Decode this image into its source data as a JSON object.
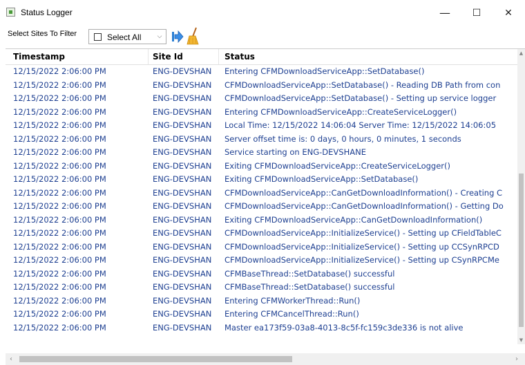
{
  "window": {
    "title": "Status Logger",
    "minimize": "—",
    "maximize": "☐",
    "close": "✕"
  },
  "toolbar": {
    "filter_label": "Select Sites To Filter",
    "select_all_label": "Select All"
  },
  "table": {
    "columns": [
      "Timestamp",
      "Site Id",
      "Status"
    ],
    "rows": [
      [
        "12/15/2022 2:06:00 PM",
        "ENG-DEVSHAN",
        "Entering CFMDownloadServiceApp::SetDatabase()"
      ],
      [
        "12/15/2022 2:06:00 PM",
        "ENG-DEVSHAN",
        "CFMDownloadServiceApp::SetDatabase() - Reading DB Path from con"
      ],
      [
        "12/15/2022 2:06:00 PM",
        "ENG-DEVSHAN",
        "CFMDownloadServiceApp::SetDatabase() - Setting up service logger"
      ],
      [
        "12/15/2022 2:06:00 PM",
        "ENG-DEVSHAN",
        "Entering CFMDownloadServiceApp::CreateServiceLogger()"
      ],
      [
        "12/15/2022 2:06:00 PM",
        "ENG-DEVSHAN",
        "Local Time: 12/15/2022 14:06:04 Server Time: 12/15/2022 14:06:05"
      ],
      [
        "12/15/2022 2:06:00 PM",
        "ENG-DEVSHAN",
        "Server offset time is: 0 days, 0 hours, 0 minutes, 1 seconds"
      ],
      [
        "12/15/2022 2:06:00 PM",
        "ENG-DEVSHAN",
        "Service starting on ENG-DEVSHANE"
      ],
      [
        "12/15/2022 2:06:00 PM",
        "ENG-DEVSHAN",
        "Exiting CFMDownloadServiceApp::CreateServiceLogger()"
      ],
      [
        "12/15/2022 2:06:00 PM",
        "ENG-DEVSHAN",
        "Exiting CFMDownloadServiceApp::SetDatabase()"
      ],
      [
        "12/15/2022 2:06:00 PM",
        "ENG-DEVSHAN",
        "CFMDownloadServiceApp::CanGetDownloadInformation() - Creating C"
      ],
      [
        "12/15/2022 2:06:00 PM",
        "ENG-DEVSHAN",
        "CFMDownloadServiceApp::CanGetDownloadInformation() - Getting Do"
      ],
      [
        "12/15/2022 2:06:00 PM",
        "ENG-DEVSHAN",
        "Exiting CFMDownloadServiceApp::CanGetDownloadInformation()"
      ],
      [
        "12/15/2022 2:06:00 PM",
        "ENG-DEVSHAN",
        "CFMDownloadServiceApp::InitializeService() - Setting up CFieldTableC"
      ],
      [
        "12/15/2022 2:06:00 PM",
        "ENG-DEVSHAN",
        "CFMDownloadServiceApp::InitializeService() - Setting up CCSynRPCD"
      ],
      [
        "12/15/2022 2:06:00 PM",
        "ENG-DEVSHAN",
        "CFMDownloadServiceApp::InitializeService() - Setting up CSynRPCMe"
      ],
      [
        "12/15/2022 2:06:00 PM",
        "ENG-DEVSHAN",
        "CFMBaseThread::SetDatabase() successful"
      ],
      [
        "12/15/2022 2:06:00 PM",
        "ENG-DEVSHAN",
        "CFMBaseThread::SetDatabase() successful"
      ],
      [
        "12/15/2022 2:06:00 PM",
        "ENG-DEVSHAN",
        "Entering CFMWorkerThread::Run()"
      ],
      [
        "12/15/2022 2:06:00 PM",
        "ENG-DEVSHAN",
        "Entering CFMCancelThread::Run()"
      ],
      [
        "12/15/2022 2:06:00 PM",
        "ENG-DEVSHAN",
        "Master ea173f59-03a8-4013-8c5f-fc159c3de336 is not alive"
      ]
    ]
  },
  "colors": {
    "row_text": "#1d3f91",
    "header_text": "#000000"
  },
  "icons": {
    "app": "status-logger-icon",
    "go": "blue-arrow-icon",
    "clear": "broom-icon"
  }
}
